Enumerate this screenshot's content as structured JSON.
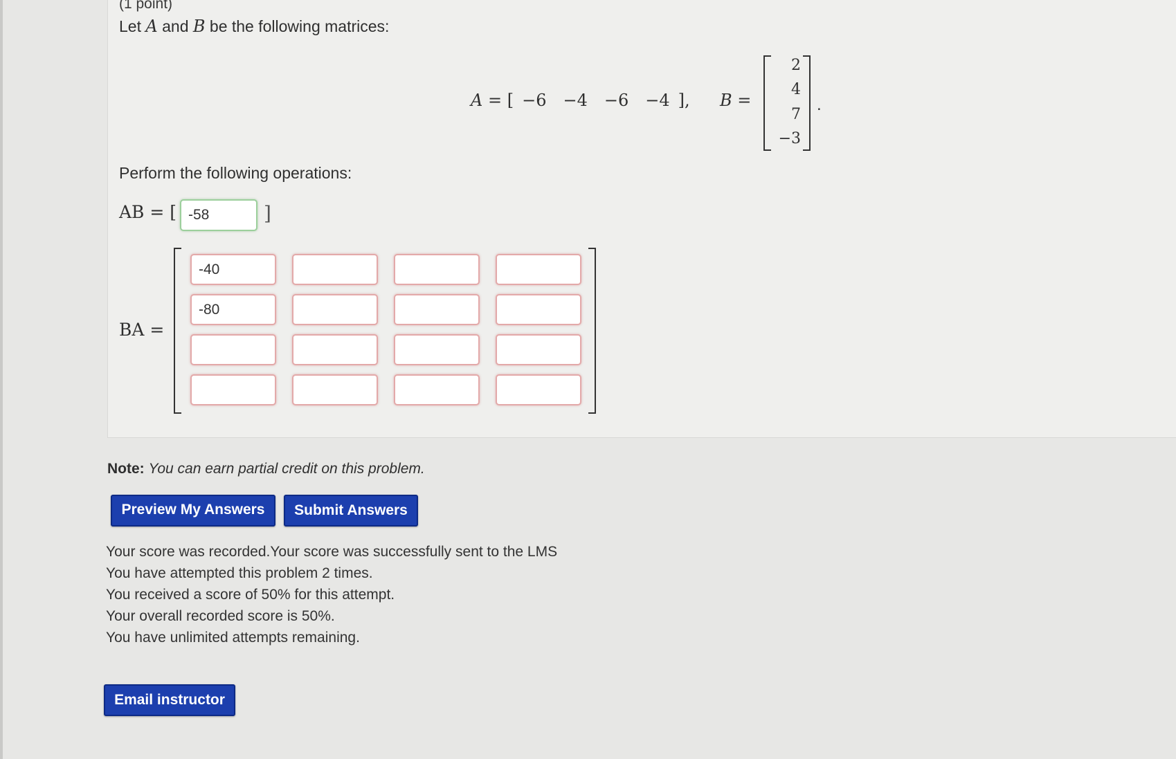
{
  "problem": {
    "points": "(1 point)",
    "intro_prefix": "Let",
    "var_a": "A",
    "intro_and": "and",
    "var_b": "B",
    "intro_suffix": "be the following matrices:",
    "matrix_a_label": "A =",
    "matrix_a_open": "[",
    "matrix_a_values": [
      "−6",
      "−4",
      "−6",
      "−4"
    ],
    "matrix_a_close": "],",
    "matrix_b_label": "B =",
    "matrix_b_values": [
      "2",
      "4",
      "7",
      "−3"
    ],
    "matrix_b_period": ".",
    "perform_text": "Perform the following operations:"
  },
  "ab": {
    "label": "AB = [",
    "close": "]",
    "value": "-58"
  },
  "ba": {
    "label": "BA =",
    "cells": [
      [
        "-40",
        "",
        "",
        ""
      ],
      [
        "-80",
        "",
        "",
        ""
      ],
      [
        "",
        "",
        "",
        ""
      ],
      [
        "",
        "",
        "",
        ""
      ]
    ]
  },
  "note": {
    "label": "Note:",
    "text": "You can earn partial credit on this problem."
  },
  "buttons": {
    "preview": "Preview My Answers",
    "submit": "Submit Answers",
    "email": "Email instructor"
  },
  "score": {
    "line1": "Your score was recorded.Your score was successfully sent to the LMS",
    "line2": "You have attempted this problem 2 times.",
    "line3": "You received a score of 50% for this attempt.",
    "line4": "Your overall recorded score is 50%.",
    "line5": "You have unlimited attempts remaining."
  },
  "colors": {
    "button_bg": "#1c3fae",
    "incorrect_border": "#e3a9a9",
    "correct_border": "#9ccf9c"
  }
}
